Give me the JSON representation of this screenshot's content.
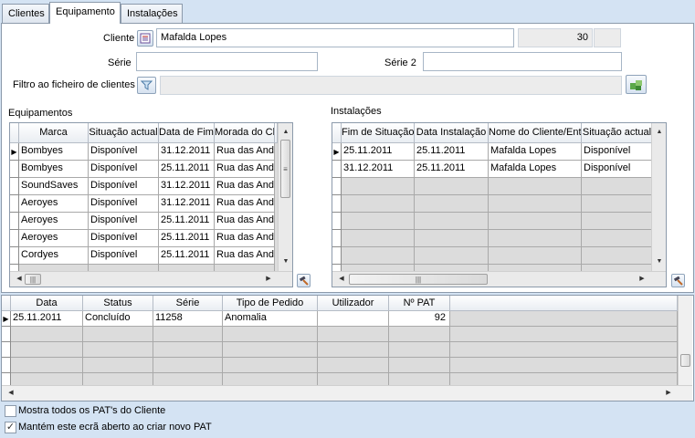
{
  "tabs": [
    "Clientes",
    "Equipamento",
    "Instalações"
  ],
  "form": {
    "cliente_label": "Cliente",
    "cliente_value": "Mafalda Lopes",
    "cliente_code": "30",
    "serie_label": "Série",
    "serie_value": "",
    "serie2_label": "Série 2",
    "serie2_value": "",
    "filtro_label": "Filtro ao ficheiro de clientes",
    "filtro_value": ""
  },
  "equip": {
    "section_label": "Equipamentos",
    "columns": [
      "Marca",
      "Situação actual",
      "Data de Fim",
      "Morada do Cl"
    ],
    "rows": [
      [
        "Bombyes",
        "Disponível",
        "31.12.2011",
        "Rua das Andorinh"
      ],
      [
        "Bombyes",
        "Disponível",
        "25.11.2011",
        "Rua das Andorinh"
      ],
      [
        "SoundSaves",
        "Disponível",
        "31.12.2011",
        "Rua das Andorinh"
      ],
      [
        "Aeroyes",
        "Disponível",
        "31.12.2011",
        "Rua das Andorinh"
      ],
      [
        "Aeroyes",
        "Disponível",
        "25.11.2011",
        "Rua das Andorinh"
      ],
      [
        "Aeroyes",
        "Disponível",
        "25.11.2011",
        "Rua das Andorinh"
      ],
      [
        "Cordyes",
        "Disponível",
        "25.11.2011",
        "Rua das Andorinh"
      ]
    ]
  },
  "inst": {
    "section_label": "Instalações",
    "columns": [
      "Fim de Situação",
      "Data Instalação",
      "Nome do Cliente/Entidade",
      "Situação actual"
    ],
    "rows": [
      [
        "25.11.2011",
        "25.11.2011",
        "Mafalda Lopes",
        "Disponível"
      ],
      [
        "31.12.2011",
        "25.11.2011",
        "Mafalda Lopes",
        "Disponível"
      ]
    ]
  },
  "pat": {
    "columns": [
      "Data",
      "Status",
      "Série",
      "Tipo de Pedido",
      "Utilizador",
      "Nº PAT"
    ],
    "rows": [
      [
        "25.11.2011",
        "Concluído",
        "11258",
        "Anomalia",
        "",
        "92"
      ]
    ]
  },
  "options": {
    "show_all_label": "Mostra todos os PAT's do Cliente",
    "show_all_checked": false,
    "keep_open_label": "Mantém este ecrã aberto ao criar novo PAT",
    "keep_open_checked": true
  },
  "icons": {
    "cliente_lookup": "list-icon",
    "filter": "funnel-icon",
    "apply_filter": "green-puzzle-icon",
    "edit": "hammer-icon"
  }
}
